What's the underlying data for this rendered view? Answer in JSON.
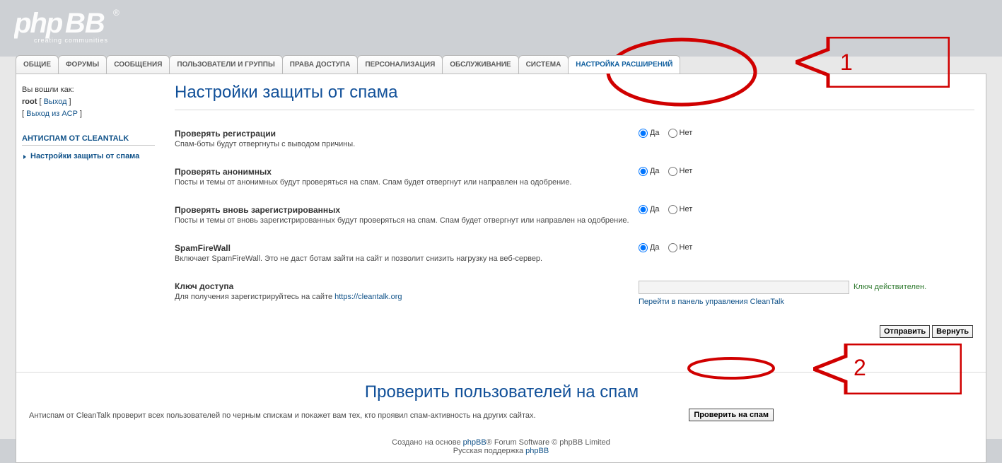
{
  "logo": {
    "name": "phpBB",
    "tagline": "creating communities",
    "reg": "®"
  },
  "tabs": [
    "ОБЩИЕ",
    "ФОРУМЫ",
    "СООБЩЕНИЯ",
    "ПОЛЬЗОВАТЕЛИ И ГРУППЫ",
    "ПРАВА ДОСТУПА",
    "ПЕРСОНАЛИЗАЦИЯ",
    "ОБСЛУЖИВАНИЕ",
    "СИСТЕМА",
    "НАСТРОЙКА РАСШИРЕНИЙ"
  ],
  "activeTabIndex": 8,
  "sidebar": {
    "login": {
      "label": "Вы вошли как:",
      "user": "root",
      "logout": "Выход",
      "acp_logout": "Выход из ACP"
    },
    "category": "АНТИСПАМ ОТ CLEANTALK",
    "items": [
      {
        "label": "Настройки защиты от спама",
        "active": true
      }
    ]
  },
  "main": {
    "title": "Настройки защиты от спама",
    "rows": [
      {
        "label": "Проверять регистрации",
        "desc": "Спам-боты будут отвергнуты с выводом причины.",
        "yes": "Да",
        "no": "Нет"
      },
      {
        "label": "Проверять анонимных",
        "desc": "Посты и темы от анонимных будут проверяться на спам. Спам будет отвергнут или направлен на одобрение.",
        "yes": "Да",
        "no": "Нет"
      },
      {
        "label": "Проверять вновь зарегистрированных",
        "desc": "Посты и темы от вновь зарегистрированных будут проверяться на спам. Спам будет отвергнут или направлен на одобрение.",
        "yes": "Да",
        "no": "Нет"
      },
      {
        "label": "SpamFireWall",
        "desc": "Включает SpamFireWall. Это не даст ботам зайти на сайт и позволит снизить нагрузку на веб-сервер.",
        "yes": "Да",
        "no": "Нет"
      }
    ],
    "key": {
      "label": "Ключ доступа",
      "desc_pre": "Для получения зарегистрируйтесь на сайте ",
      "desc_link": "https://cleantalk.org",
      "status": "Ключ действителен.",
      "cp_link": "Перейти в панель управления CleanTalk"
    },
    "actions": {
      "submit": "Отправить",
      "reset": "Вернуть"
    }
  },
  "check": {
    "title": "Проверить пользователей на спам",
    "desc": "Антиспам от CleanTalk проверит всех пользователей по черным спискам и покажет вам тех, кто проявил спам-активность на других сайтах.",
    "btn": "Проверить на спам"
  },
  "footer": {
    "line1_pre": "Создано на основе ",
    "line1_link": "phpBB",
    "line1_post": "® Forum Software © phpBB Limited",
    "line2_pre": "Русская поддержка ",
    "line2_link": "phpBB"
  },
  "annot": {
    "num1": "1",
    "num2": "2"
  }
}
